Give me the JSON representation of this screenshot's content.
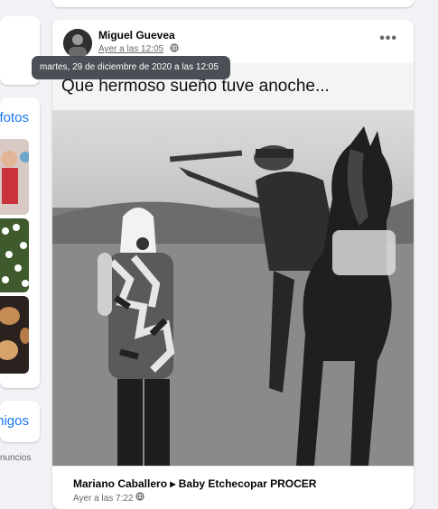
{
  "left_column": {
    "photos_link": "fotos",
    "friends_link": "migos",
    "ads_text": "nuncios"
  },
  "post": {
    "author": "Miguel Guevea",
    "timestamp": "Ayer a las 12:05",
    "privacy_icon": "globe-icon",
    "more_icon": "•••",
    "tooltip": "martes, 29 de diciembre de 2020 a las 12:05",
    "photo": {
      "caption": "Que hermoso sueño tuve anoche..."
    },
    "shared": {
      "author": "Mariano Caballero",
      "arrow": "▸",
      "target": "Baby Etchecopar PROCER",
      "timestamp": "Ayer a las 7:22"
    }
  },
  "colors": {
    "link": "#1877f2",
    "secondary_text": "#65676b",
    "background": "#f0f2f5",
    "tooltip_bg": "#444950"
  }
}
